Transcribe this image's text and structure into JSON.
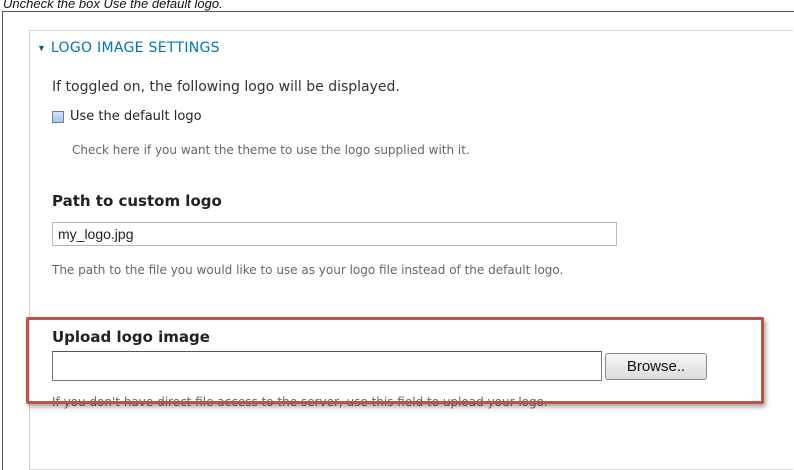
{
  "instruction": "Uncheck the box Use the default logo.",
  "fieldset": {
    "legend": "LOGO IMAGE SETTINGS",
    "arrow_glyph": "▼",
    "description": "If toggled on, the following logo will be displayed."
  },
  "default_logo": {
    "label": "Use the default logo",
    "checked": false,
    "help": "Check here if you want the theme to use the logo supplied with it."
  },
  "logo_path": {
    "title": "Path to custom logo",
    "value": "my_logo.jpg",
    "help": "The path to the file you would like to use as your logo file instead of the default logo."
  },
  "logo_upload": {
    "title": "Upload logo image",
    "value": "",
    "browse_label": "Browse..",
    "help": "If you don't have direct file access to the server, use this field to upload your logo."
  },
  "colors": {
    "link_blue": "#0074bd",
    "highlight_red": "#c0504d"
  }
}
